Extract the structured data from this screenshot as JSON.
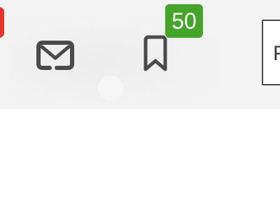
{
  "toolbar": {
    "notification_color": "#e8322b",
    "mail": {
      "icon": "mail-icon"
    },
    "bookmarks": {
      "icon": "bookmark-icon",
      "count": "50",
      "badge_color": "#44a52a"
    },
    "search": {
      "visible_text": "F"
    }
  }
}
